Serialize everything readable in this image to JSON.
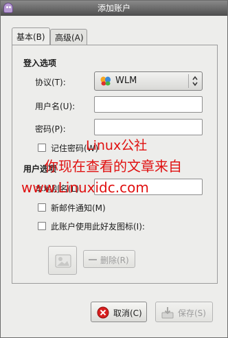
{
  "window": {
    "title": "添加账户"
  },
  "tabs": [
    {
      "label": "基本(B)"
    },
    {
      "label": "高级(A)"
    }
  ],
  "login": {
    "section_title": "登入选项",
    "protocol_label": "协议(T):",
    "protocol_value": "WLM",
    "username_label": "用户名(U):",
    "username_value": "",
    "password_label": "密码(P):",
    "password_value": "",
    "remember_label": "记住密码(W)",
    "remember_checked": false
  },
  "user": {
    "section_title": "用户选项",
    "alias_label": "本地别名(L):",
    "alias_value": "",
    "new_mail_label": "新邮件通知(M)",
    "new_mail_checked": false,
    "buddy_icon_label": "此账户使用此好友图标(I):",
    "buddy_icon_checked": false,
    "remove_label": "删除(R)"
  },
  "footer": {
    "cancel_label": "取消(C)",
    "save_label": "保存(S)"
  },
  "watermark": {
    "line1": "Linux公社",
    "line2": "你现在查看的文章来自",
    "line3": "www.Linuxidc.com"
  }
}
